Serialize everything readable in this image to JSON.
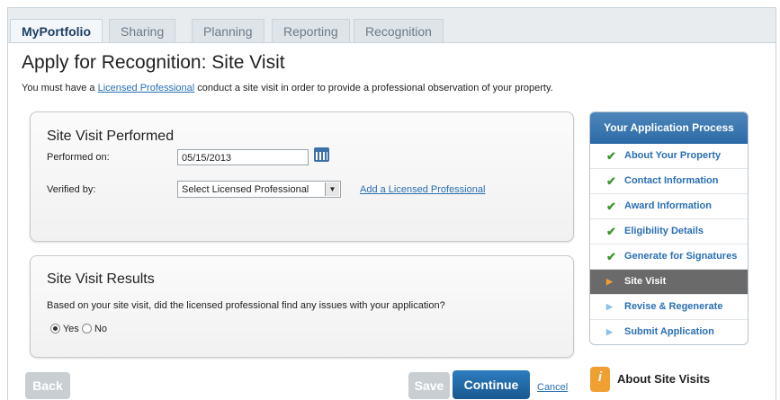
{
  "tabs": [
    {
      "label": "MyPortfolio"
    },
    {
      "label": "Sharing"
    },
    {
      "label": "Planning"
    },
    {
      "label": "Reporting"
    },
    {
      "label": "Recognition"
    }
  ],
  "page": {
    "title": "Apply for Recognition: Site Visit",
    "intro_before": "You must have a ",
    "intro_link": "Licensed Professional",
    "intro_after": " conduct a site visit in order to provide a professional observation of your property."
  },
  "site_visit_performed": {
    "title": "Site Visit Performed",
    "performed_on_label": "Performed on:",
    "performed_on_value": "05/15/2013",
    "verified_by_label": "Verified by:",
    "verified_by_selected": "Select Licensed Professional",
    "add_link": "Add a Licensed Professional"
  },
  "site_visit_results": {
    "title": "Site Visit Results",
    "question": "Based on your site visit, did the licensed professional find any issues with your application?",
    "yes_label": "Yes",
    "no_label": "No",
    "selected": "Yes"
  },
  "process": {
    "heading": "Your Application Process",
    "steps": [
      {
        "label": "About Your Property",
        "status": "complete"
      },
      {
        "label": "Contact Information",
        "status": "complete"
      },
      {
        "label": "Award Information",
        "status": "complete"
      },
      {
        "label": "Eligibility Details",
        "status": "complete"
      },
      {
        "label": "Generate for Signatures",
        "status": "complete"
      },
      {
        "label": "Site Visit",
        "status": "current"
      },
      {
        "label": "Revise & Regenerate",
        "status": "pending"
      },
      {
        "label": "Submit Application",
        "status": "pending"
      }
    ]
  },
  "buttons": {
    "back": "Back",
    "save": "Save",
    "continue": "Continue",
    "cancel": "Cancel"
  },
  "about": {
    "icon_letter": "i",
    "label": "About Site Visits"
  },
  "colors": {
    "accent": "#2c6aa6",
    "check": "#3a9a2a",
    "current_step": "#6a6a6a"
  }
}
